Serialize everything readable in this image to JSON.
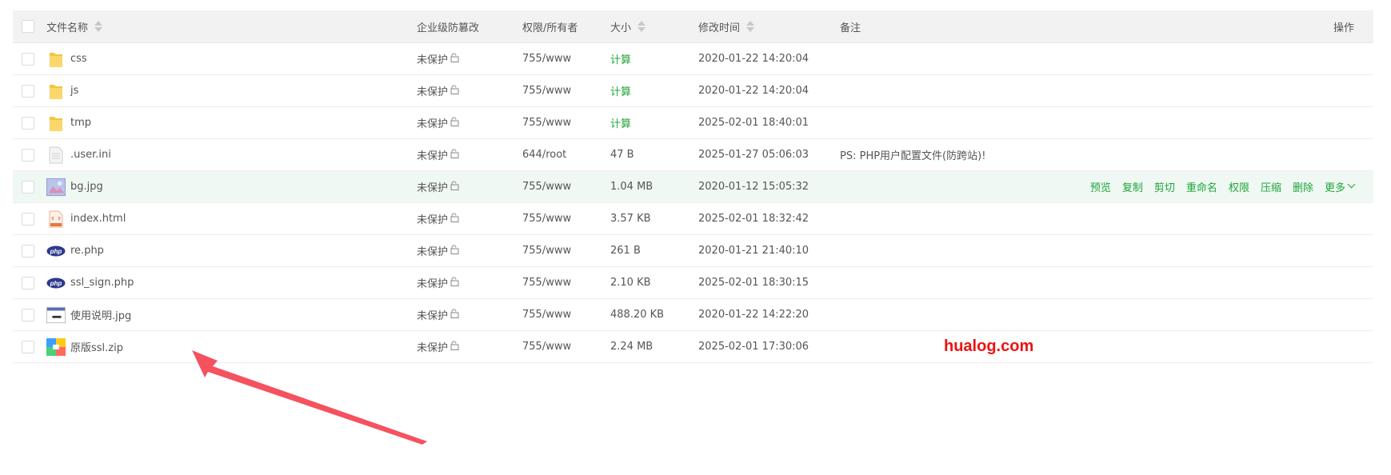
{
  "header": {
    "name": "文件名称",
    "protect": "企业级防篡改",
    "perm": "权限/所有者",
    "size": "大小",
    "mtime": "修改时间",
    "note": "备注",
    "ops": "操作"
  },
  "rows": [
    {
      "name": "css",
      "icon": "folder-icon",
      "protect": "未保护",
      "perm": "755/www",
      "size": "计算",
      "mtime": "2020-01-22 14:20:04",
      "note": ""
    },
    {
      "name": "js",
      "icon": "folder-icon",
      "protect": "未保护",
      "perm": "755/www",
      "size": "计算",
      "mtime": "2020-01-22 14:20:04",
      "note": ""
    },
    {
      "name": "tmp",
      "icon": "folder-icon",
      "protect": "未保护",
      "perm": "755/www",
      "size": "计算",
      "mtime": "2025-02-01 18:40:01",
      "note": ""
    },
    {
      "name": ".user.ini",
      "icon": "text-file-icon",
      "protect": "未保护",
      "perm": "644/root",
      "size": "47 B",
      "mtime": "2025-01-27 05:06:03",
      "note": "PS: PHP用户配置文件(防跨站)!"
    },
    {
      "name": "bg.jpg",
      "icon": "image-thumbnail-icon",
      "protect": "未保护",
      "perm": "755/www",
      "size": "1.04 MB",
      "mtime": "2020-01-12 15:05:32",
      "note": ""
    },
    {
      "name": "index.html",
      "icon": "html-file-icon",
      "protect": "未保护",
      "perm": "755/www",
      "size": "3.57 KB",
      "mtime": "2025-02-01 18:32:42",
      "note": ""
    },
    {
      "name": "re.php",
      "icon": "php-file-icon",
      "protect": "未保护",
      "perm": "755/www",
      "size": "261 B",
      "mtime": "2020-01-21 21:40:10",
      "note": ""
    },
    {
      "name": "ssl_sign.php",
      "icon": "php-file-icon",
      "protect": "未保护",
      "perm": "755/www",
      "size": "2.10 KB",
      "mtime": "2025-02-01 18:30:15",
      "note": ""
    },
    {
      "name": "使用说明.jpg",
      "icon": "screenshot-thumbnail-icon",
      "protect": "未保护",
      "perm": "755/www",
      "size": "488.20 KB",
      "mtime": "2020-01-22 14:22:20",
      "note": ""
    },
    {
      "name": "原版ssl.zip",
      "icon": "zip-file-icon",
      "protect": "未保护",
      "perm": "755/www",
      "size": "2.24 MB",
      "mtime": "2025-02-01 17:30:06",
      "note": ""
    }
  ],
  "hover_row_actions": [
    "预览",
    "复制",
    "剪切",
    "重命名",
    "权限",
    "压缩",
    "删除",
    "更多"
  ],
  "watermark": "hualog.com",
  "colors": {
    "accent": "#20a53a",
    "arrow": "#f5525f",
    "watermark": "#ee1111"
  }
}
